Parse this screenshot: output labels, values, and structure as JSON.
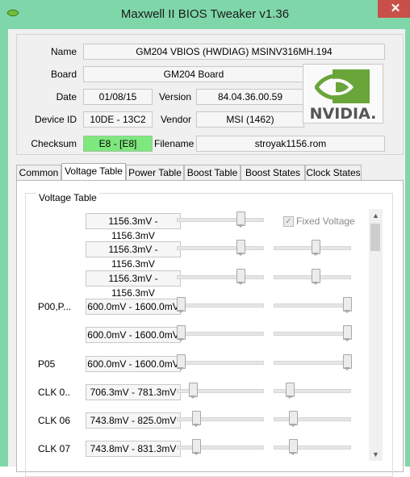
{
  "window": {
    "title": "Maxwell II BIOS Tweaker v1.36",
    "close_glyph": "✕"
  },
  "info": {
    "name_label": "Name",
    "name_value": "GM204 VBIOS (HWDIAG) MSINV316MH.194",
    "board_label": "Board",
    "board_value": "GM204 Board",
    "date_label": "Date",
    "date_value": "01/08/15",
    "version_label": "Version",
    "version_value": "84.04.36.00.59",
    "device_label": "Device ID",
    "device_value": "10DE - 13C2",
    "vendor_label": "Vendor",
    "vendor_value": "MSI (1462)",
    "checksum_label": "Checksum",
    "checksum_value": "E8 - [E8]",
    "filename_label": "Filename",
    "filename_value": "stroyak1156.rom",
    "logo_text": "NVIDIA."
  },
  "tabs": [
    "Common",
    "Voltage Table",
    "Power Table",
    "Boost Table",
    "Boost States",
    "Clock States"
  ],
  "active_tab": "Voltage Table",
  "voltage_table": {
    "title": "Voltage Table",
    "fixed_voltage_label": "Fixed Voltage",
    "fixed_voltage_checked": true,
    "rows": [
      {
        "label": "",
        "value": "1156.3mV - 1156.3mV",
        "left": 0.75,
        "right": null
      },
      {
        "label": "",
        "value": "1156.3mV - 1156.3mV",
        "left": 0.75,
        "right": 0.55
      },
      {
        "label": "",
        "value": "1156.3mV - 1156.3mV",
        "left": 0.75,
        "right": 0.55
      },
      {
        "label": "P00,P...",
        "value": "600.0mV - 1600.0mV",
        "left": 0.0,
        "right": 1.0
      },
      {
        "label": "",
        "value": "600.0mV - 1600.0mV",
        "left": 0.0,
        "right": 1.0
      },
      {
        "label": "P05",
        "value": "600.0mV - 1600.0mV",
        "left": 0.0,
        "right": 1.0
      },
      {
        "label": "CLK 0..",
        "value": "706.3mV - 781.3mV",
        "left": 0.15,
        "right": 0.18
      },
      {
        "label": "CLK 06",
        "value": "743.8mV - 825.0mV",
        "left": 0.19,
        "right": 0.22
      },
      {
        "label": "CLK 07",
        "value": "743.8mV - 831.3mV",
        "left": 0.19,
        "right": 0.22
      }
    ]
  },
  "colors": {
    "title_bar": "#7fd7a9",
    "checksum_ok": "#7ee87e",
    "close_button": "#c9504a"
  }
}
